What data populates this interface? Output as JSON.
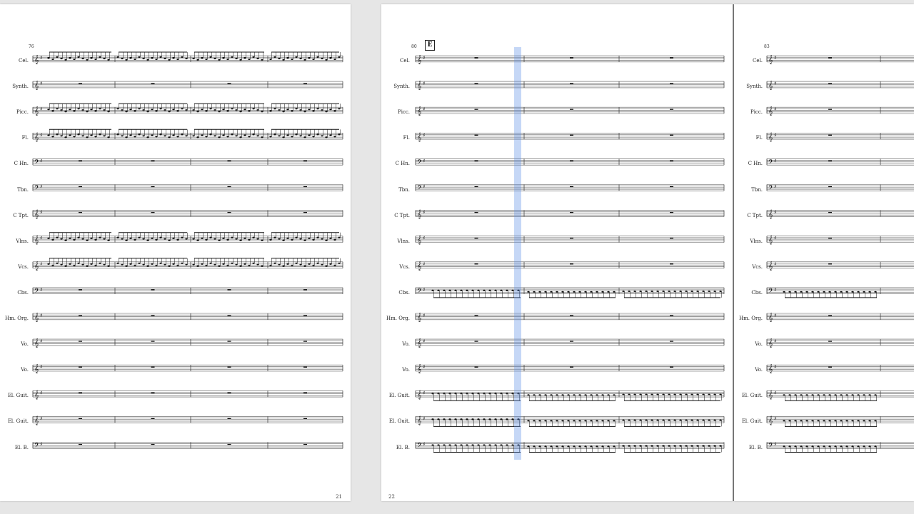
{
  "score": {
    "pages": [
      {
        "page_number": "21",
        "measure_number": "76",
        "instruments": [
          "Cel.",
          "Synth.",
          "Picc.",
          "Fl.",
          "C Hn.",
          "Tbn.",
          "C Tpt.",
          "Vlns.",
          "Vcs.",
          "Cbs.",
          "Hm. Org.",
          "Vo.",
          "Vo.",
          "El. Guit.",
          "El. Guit.",
          "El. B."
        ]
      },
      {
        "page_number": "22",
        "measure_number": "80",
        "rehearsal_mark": "E",
        "instruments": [
          "Cel.",
          "Synth.",
          "Picc.",
          "Fl.",
          "C Hn.",
          "Tbn.",
          "C Tpt.",
          "Vlns.",
          "Vcs.",
          "Cbs.",
          "Hm. Org.",
          "Vo.",
          "Vo.",
          "El. Guit.",
          "El. Guit.",
          "El. B."
        ]
      },
      {
        "measure_number": "83",
        "instruments": [
          "Cel.",
          "Synth.",
          "Picc.",
          "Fl.",
          "C Hn.",
          "Tbn.",
          "C Tpt.",
          "Vlns.",
          "Vcs.",
          "Cbs.",
          "Hm. Org.",
          "Vo.",
          "Vo.",
          "El. Guit.",
          "El. Guit.",
          "El. B."
        ]
      }
    ],
    "clefs": [
      "treble",
      "treble",
      "treble",
      "treble",
      "bass",
      "bass",
      "treble",
      "treble",
      "treble",
      "bass",
      "treble",
      "treble",
      "treble",
      "treble",
      "treble",
      "bass"
    ],
    "colors": {
      "page": "#ffffff",
      "background": "#e6e6e6",
      "playback_cursor": "#5a8ce6",
      "note_highlight": "#e03030"
    }
  }
}
